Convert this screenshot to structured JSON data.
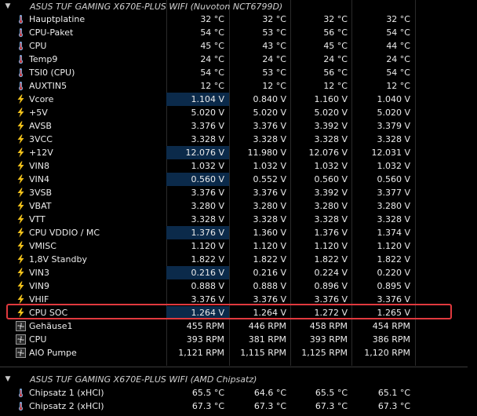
{
  "colors": {
    "background": "#000000",
    "highlight_cell": "#0b2a4a",
    "selection_box": "#e0393e",
    "temp_icon": "#7fa7d6",
    "volt_icon": "#f2c21b",
    "fan_icon": "#cfcfcf"
  },
  "group1": {
    "title": "ASUS TUF GAMING X670E-PLUS WIFI (Nuvoton NCT6799D)",
    "icon": "chevron-down-icon"
  },
  "group2": {
    "title": "ASUS TUF GAMING X670E-PLUS WIFI (AMD Chipsatz)",
    "icon": "chevron-down-icon"
  },
  "rows": [
    {
      "type": "temp",
      "label": "Hauptplatine",
      "v": [
        "32 °C",
        "32 °C",
        "32 °C",
        "32 °C"
      ]
    },
    {
      "type": "temp",
      "label": "CPU-Paket",
      "v": [
        "54 °C",
        "53 °C",
        "56 °C",
        "54 °C"
      ]
    },
    {
      "type": "temp",
      "label": "CPU",
      "v": [
        "45 °C",
        "43 °C",
        "45 °C",
        "44 °C"
      ]
    },
    {
      "type": "temp",
      "label": "Temp9",
      "v": [
        "24 °C",
        "24 °C",
        "24 °C",
        "24 °C"
      ]
    },
    {
      "type": "temp",
      "label": "TSI0 (CPU)",
      "v": [
        "54 °C",
        "53 °C",
        "56 °C",
        "54 °C"
      ]
    },
    {
      "type": "temp",
      "label": "AUXTIN5",
      "v": [
        "12 °C",
        "12 °C",
        "12 °C",
        "12 °C"
      ]
    },
    {
      "type": "volt",
      "label": "Vcore",
      "hl": true,
      "v": [
        "1.104 V",
        "0.840 V",
        "1.160 V",
        "1.040 V"
      ]
    },
    {
      "type": "volt",
      "label": "+5V",
      "v": [
        "5.020 V",
        "5.020 V",
        "5.020 V",
        "5.020 V"
      ]
    },
    {
      "type": "volt",
      "label": "AVSB",
      "v": [
        "3.376 V",
        "3.376 V",
        "3.392 V",
        "3.379 V"
      ]
    },
    {
      "type": "volt",
      "label": "3VCC",
      "v": [
        "3.328 V",
        "3.328 V",
        "3.328 V",
        "3.328 V"
      ]
    },
    {
      "type": "volt",
      "label": "+12V",
      "hl": true,
      "v": [
        "12.076 V",
        "11.980 V",
        "12.076 V",
        "12.031 V"
      ]
    },
    {
      "type": "volt",
      "label": "VIN8",
      "v": [
        "1.032 V",
        "1.032 V",
        "1.032 V",
        "1.032 V"
      ]
    },
    {
      "type": "volt",
      "label": "VIN4",
      "hl": true,
      "v": [
        "0.560 V",
        "0.552 V",
        "0.560 V",
        "0.560 V"
      ]
    },
    {
      "type": "volt",
      "label": "3VSB",
      "v": [
        "3.376 V",
        "3.376 V",
        "3.392 V",
        "3.377 V"
      ]
    },
    {
      "type": "volt",
      "label": "VBAT",
      "v": [
        "3.280 V",
        "3.280 V",
        "3.280 V",
        "3.280 V"
      ]
    },
    {
      "type": "volt",
      "label": "VTT",
      "v": [
        "3.328 V",
        "3.328 V",
        "3.328 V",
        "3.328 V"
      ]
    },
    {
      "type": "volt",
      "label": "CPU VDDIO / MC",
      "hl": true,
      "v": [
        "1.376 V",
        "1.360 V",
        "1.376 V",
        "1.374 V"
      ]
    },
    {
      "type": "volt",
      "label": "VMISC",
      "v": [
        "1.120 V",
        "1.120 V",
        "1.120 V",
        "1.120 V"
      ]
    },
    {
      "type": "volt",
      "label": "1,8V Standby",
      "v": [
        "1.822 V",
        "1.822 V",
        "1.822 V",
        "1.822 V"
      ]
    },
    {
      "type": "volt",
      "label": "VIN3",
      "hl": true,
      "v": [
        "0.216 V",
        "0.216 V",
        "0.224 V",
        "0.220 V"
      ]
    },
    {
      "type": "volt",
      "label": "VIN9",
      "v": [
        "0.888 V",
        "0.888 V",
        "0.896 V",
        "0.895 V"
      ]
    },
    {
      "type": "volt",
      "label": "VHIF",
      "v": [
        "3.376 V",
        "3.376 V",
        "3.376 V",
        "3.376 V"
      ]
    },
    {
      "type": "volt",
      "label": "CPU SOC",
      "hl": true,
      "v": [
        "1.264 V",
        "1.264 V",
        "1.272 V",
        "1.265 V"
      ]
    },
    {
      "type": "fan",
      "label": "Gehäuse1",
      "v": [
        "455 RPM",
        "446 RPM",
        "458 RPM",
        "454 RPM"
      ]
    },
    {
      "type": "fan",
      "label": "CPU",
      "v": [
        "393 RPM",
        "381 RPM",
        "393 RPM",
        "386 RPM"
      ]
    },
    {
      "type": "fan",
      "label": "AIO Pumpe",
      "v": [
        "1,121 RPM",
        "1,115 RPM",
        "1,125 RPM",
        "1,120 RPM"
      ]
    }
  ],
  "rows2": [
    {
      "type": "temp",
      "label": "Chipsatz 1 (xHCI)",
      "v": [
        "65.5 °C",
        "64.6 °C",
        "65.5 °C",
        "65.1 °C"
      ]
    },
    {
      "type": "temp",
      "label": "Chipsatz 2 (xHCI)",
      "v": [
        "67.3 °C",
        "67.3 °C",
        "67.3 °C",
        "67.3 °C"
      ]
    }
  ]
}
